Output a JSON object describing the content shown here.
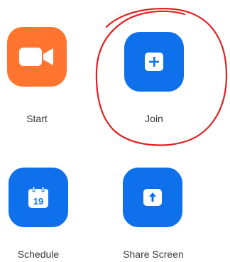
{
  "buttons": {
    "start": {
      "label": "Start",
      "icon": "video-camera-icon",
      "color": "#FF742E"
    },
    "join": {
      "label": "Join",
      "icon": "plus-icon",
      "color": "#0E71EB"
    },
    "schedule": {
      "label": "Schedule",
      "icon": "calendar-icon",
      "calendar_day": "19",
      "color": "#0E71EB"
    },
    "share_screen": {
      "label": "Share Screen",
      "icon": "share-up-arrow-icon",
      "color": "#0E71EB"
    }
  },
  "annotation": {
    "shape": "hand-drawn-circle",
    "color": "#E02020",
    "target": "join"
  }
}
